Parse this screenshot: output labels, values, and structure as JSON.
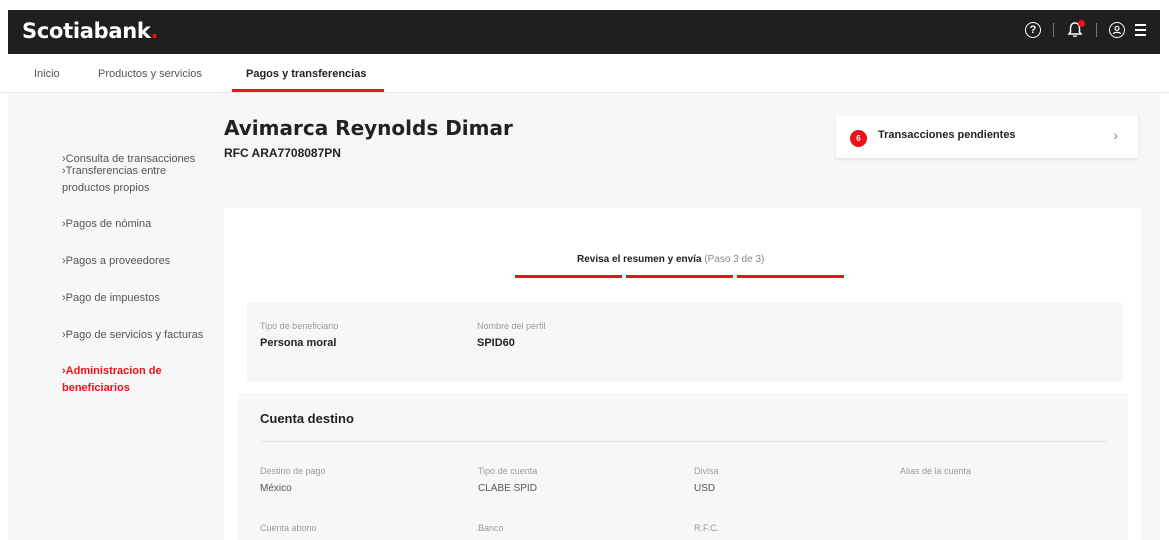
{
  "header": {
    "logo": "Scotiabank",
    "logo_dot": ".",
    "help_icon_label": "?",
    "icons": [
      "help-icon",
      "notification-bell-icon",
      "user-icon",
      "menu-icon"
    ]
  },
  "tabs": [
    {
      "label": "Inicio"
    },
    {
      "label": "Productos y servicios"
    },
    {
      "label": "Pagos y transferencias"
    }
  ],
  "sidebar": {
    "items": [
      {
        "label": "Consulta de transacciones"
      },
      {
        "label": "Transferencias entre productos propios"
      },
      {
        "label": "Pagos de nómina"
      },
      {
        "label": "Pagos a proveedores"
      },
      {
        "label": "Pago de impuestos"
      },
      {
        "label": "Pago de servicios y facturas"
      },
      {
        "label": "Administracion de beneficiarios"
      }
    ]
  },
  "client": {
    "name": "Avimarca Reynolds Dimar",
    "rfc": "RFC ARA7708087PN"
  },
  "pending": {
    "count": "6",
    "label": "Transacciones pendientes",
    "chevron": "›"
  },
  "steps": {
    "title": "Revisa el resumen y envía",
    "progress": "(Paso 3 de 3)",
    "current": 3,
    "total": 3
  },
  "summary": {
    "beneficiary_type_label": "Tipo de beneficiario",
    "beneficiary_type_value": "Persona moral",
    "profile_name_label": "Nombre del perfil",
    "profile_name_value": "SPID60"
  },
  "destination": {
    "title": "Cuenta destino",
    "fields": [
      {
        "label": "Destino de pago",
        "value": "México"
      },
      {
        "label": "Tipo de cuenta",
        "value": "CLABE SPID"
      },
      {
        "label": "Divisa",
        "value": "USD"
      },
      {
        "label": "Alias de la cuenta",
        "value": ""
      },
      {
        "label": "Cuenta abono",
        "value": ""
      },
      {
        "label": "Banco",
        "value": ""
      },
      {
        "label": "R.F.C.",
        "value": ""
      }
    ]
  },
  "colors": {
    "brand_red": "#ec111a",
    "header_bg": "#1f1f1f",
    "content_bg": "#f7f7f7"
  }
}
